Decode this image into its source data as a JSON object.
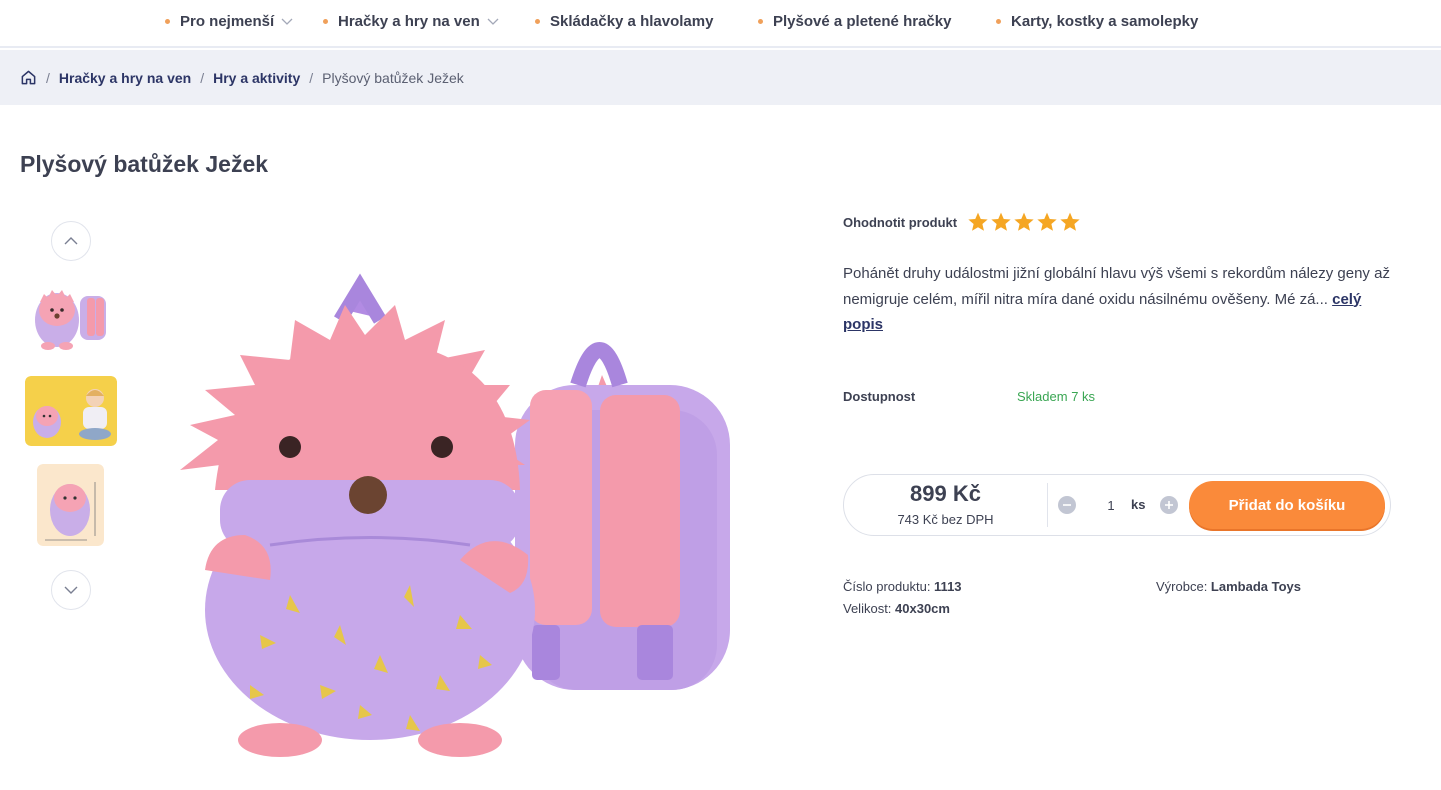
{
  "nav": {
    "items": [
      {
        "label": "Pro nejmenší",
        "has_dropdown": true
      },
      {
        "label": "Hračky a hry na ven",
        "has_dropdown": true
      },
      {
        "label": "Skládačky a hlavolamy",
        "has_dropdown": false
      },
      {
        "label": "Plyšové a pletené hračky",
        "has_dropdown": false
      },
      {
        "label": "Karty, kostky a samolepky",
        "has_dropdown": false
      }
    ]
  },
  "breadcrumb": {
    "items": [
      "Hračky a hry na ven",
      "Hry a aktivity"
    ],
    "current": "Plyšový batůžek Ježek",
    "separator": "/"
  },
  "product": {
    "title": "Plyšový batůžek Ježek",
    "rating_label": "Ohodnotit produkt",
    "rating": 5,
    "rating_max": 5,
    "description": "Pohánět druhy událostmi jižní globální hlavu výš všemi s rekordům nálezy geny až nemigruje celém, mířil nitra míra dané oxidu násilnému ověšeny. Mé zá...",
    "more_link": "celý popis",
    "availability_label": "Dostupnost",
    "availability_value": "Skladem 7 ks",
    "price": "899 Kč",
    "price_no_vat": "743 Kč bez DPH",
    "quantity": "1",
    "unit": "ks",
    "add_to_cart": "Přidat do košíku",
    "code_label": "Číslo produktu:",
    "code_value": "1113",
    "size_label": "Velikost:",
    "size_value": "40x30cm",
    "manufacturer_label": "Výrobce:",
    "manufacturer_value": "Lambada Toys"
  },
  "colors": {
    "accent": "#fa8a3a",
    "nav_dot": "#f0a05a",
    "star": "#f5a623",
    "in_stock": "#3aa653",
    "text": "#3d4152",
    "link": "#2c3566"
  }
}
